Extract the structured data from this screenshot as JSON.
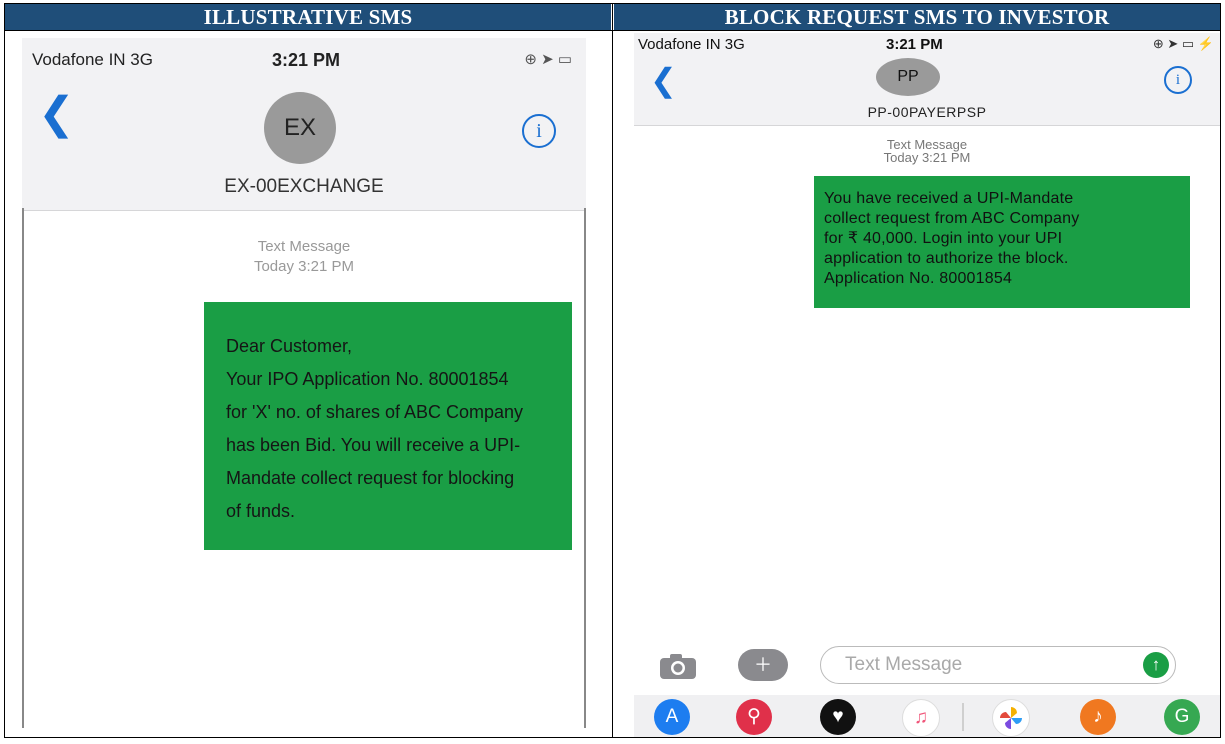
{
  "headers": {
    "left": "ILLUSTRATIVE SMS",
    "right": "BLOCK REQUEST SMS TO INVESTOR"
  },
  "left_phone": {
    "status": {
      "carrier": "Vodafone IN  3G",
      "time": "3:21 PM",
      "icons": "⊕ ➤ ▭"
    },
    "contact": {
      "initials": "EX",
      "name": "EX-00EXCHANGE"
    },
    "timestamp": {
      "label": "Text Message",
      "time": "Today 3:21 PM"
    },
    "message": {
      "lines": [
        "Dear Customer,",
        "Your IPO Application No. 80001854",
        "for 'X' no. of shares of ABC Company",
        "has been Bid. You will receive a UPI-",
        "Mandate collect request for blocking",
        "of funds."
      ]
    }
  },
  "right_phone": {
    "status": {
      "carrier": "Vodafone IN  3G",
      "time": "3:21 PM",
      "icons": "⊕ ➤ ▭ ⚡"
    },
    "contact": {
      "initials": "PP",
      "name": "PP-00PAYERPSP"
    },
    "timestamp": {
      "label": "Text Message",
      "time": "Today 3:21 PM"
    },
    "message": {
      "lines": [
        "You have received a UPI-Mandate",
        "collect request from ABC Company",
        "for ₹ 40,000. Login into your UPI",
        "application to authorize the block.",
        "Application No. 80001854"
      ]
    },
    "composer": {
      "placeholder": "Text Message"
    },
    "dock_icons": [
      "app-store-icon",
      "search-images-icon",
      "digital-touch-icon",
      "music-icon",
      "photos-icon",
      "garageband-icon",
      "maps-icon"
    ]
  },
  "colors": {
    "header_bg": "#1f4e79",
    "bubble": "#1a9e45",
    "ios_blue": "#1a6fd1"
  }
}
